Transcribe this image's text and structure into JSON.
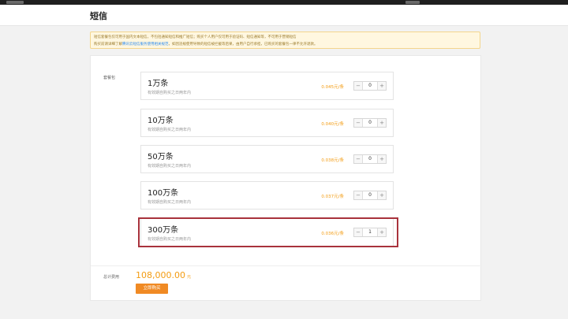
{
  "page": {
    "title": "短信"
  },
  "notice": {
    "line1": "短信套餐包仅可用于国内文本短信，不包括通知短信和推广短信；购买个人用户仅可用于验证码、短信通知等，不可用于营销短信",
    "line2_prefix": "购买前请详细了解",
    "line2_link": "腾讯云短信服务使用相关规范",
    "line2_suffix": "，如因违规使用导致的短信被拦截等后果，由用户自行承担，已购买的套餐包一律不允许退款。"
  },
  "packages_label": "套餐包",
  "packages": [
    {
      "name": "1万条",
      "desc": "有效期自购买之日两年内",
      "price": "0.045元/条",
      "qty": "0"
    },
    {
      "name": "10万条",
      "desc": "有效期自购买之日两年内",
      "price": "0.040元/条",
      "qty": "0"
    },
    {
      "name": "50万条",
      "desc": "有效期自购买之日两年内",
      "price": "0.038元/条",
      "qty": "0"
    },
    {
      "name": "100万条",
      "desc": "有效期自购买之日两年内",
      "price": "0.037元/条",
      "qty": "0"
    },
    {
      "name": "300万条",
      "desc": "有效期自购买之日两年内",
      "price": "0.036元/条",
      "qty": "1"
    }
  ],
  "stepper": {
    "minus": "−",
    "plus": "+"
  },
  "total": {
    "label": "总计费用",
    "amount": "108,000.00",
    "unit": "元"
  },
  "buy_button": "立即购买",
  "colors": {
    "accent": "#f39c12",
    "button": "#f08a24",
    "highlight": "#a8323c",
    "link": "#2d8cf0"
  }
}
